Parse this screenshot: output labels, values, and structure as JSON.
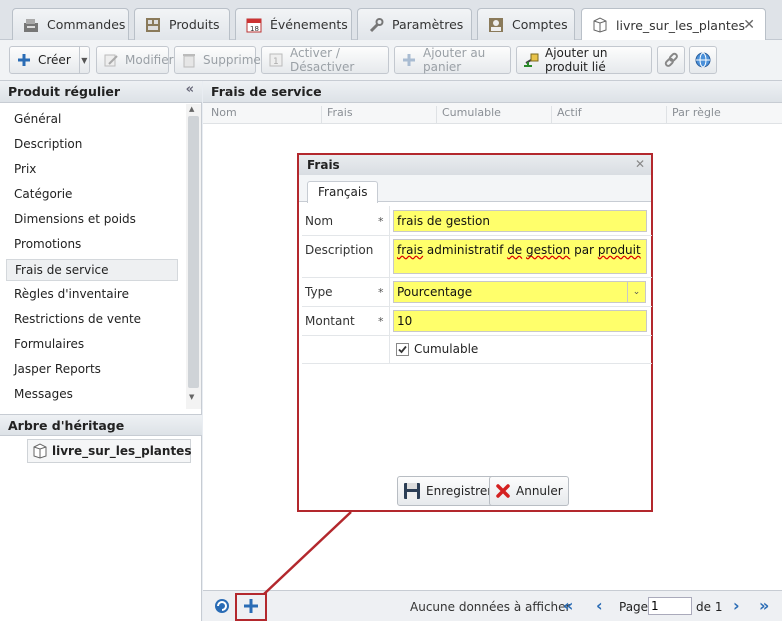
{
  "tabs": [
    {
      "label": "Commandes",
      "icon": "cash-register-icon"
    },
    {
      "label": "Produits",
      "icon": "products-icon"
    },
    {
      "label": "Événements",
      "icon": "calendar-icon"
    },
    {
      "label": "Paramètres",
      "icon": "wrench-icon"
    },
    {
      "label": "Comptes",
      "icon": "accounts-icon"
    },
    {
      "label": "livre_sur_les_plantes",
      "icon": "product-box-icon",
      "active": true
    }
  ],
  "toolbar": {
    "create": "Créer",
    "modify": "Modifier",
    "delete": "Supprimer",
    "toggle": "Activer / Désactiver",
    "add_cart": "Ajouter au panier",
    "add_linked": "Ajouter un produit lié"
  },
  "left": {
    "title": "Produit régulier",
    "items": [
      {
        "label": "Général"
      },
      {
        "label": "Description"
      },
      {
        "label": "Prix"
      },
      {
        "label": "Catégorie"
      },
      {
        "label": "Dimensions et poids"
      },
      {
        "label": "Promotions"
      },
      {
        "label": "Frais de service",
        "selected": true
      },
      {
        "label": "Règles d'inventaire"
      },
      {
        "label": "Restrictions de vente"
      },
      {
        "label": "Formulaires"
      },
      {
        "label": "Jasper Reports"
      },
      {
        "label": "Messages"
      }
    ],
    "tree_title": "Arbre d'héritage",
    "tree_node": "livre_sur_les_plantes"
  },
  "main": {
    "title": "Frais de service",
    "columns": [
      "Nom",
      "Frais",
      "Cumulable",
      "Actif",
      "Par règle"
    ]
  },
  "paging": {
    "empty": "Aucune données à afficher",
    "page_label": "Page",
    "page_value": "1",
    "of_label": "de 1"
  },
  "dialog": {
    "title": "Frais",
    "tab": "Français",
    "name_label": "Nom",
    "name_value": "frais de gestion",
    "desc_label": "Description",
    "desc_value_parts": [
      "frais",
      " administratif ",
      "de",
      " ",
      "gestion",
      " par ",
      "produit"
    ],
    "type_label": "Type",
    "type_value": "Pourcentage",
    "amount_label": "Montant",
    "amount_value": "10",
    "required_mark": "*",
    "cumulable_label": "Cumulable",
    "cumulable_checked": true,
    "save": "Enregistrer",
    "cancel": "Annuler"
  },
  "colors": {
    "highlight": "#ffff6b",
    "annotation": "#b3282d",
    "add_icon": "#2a6cb5"
  }
}
